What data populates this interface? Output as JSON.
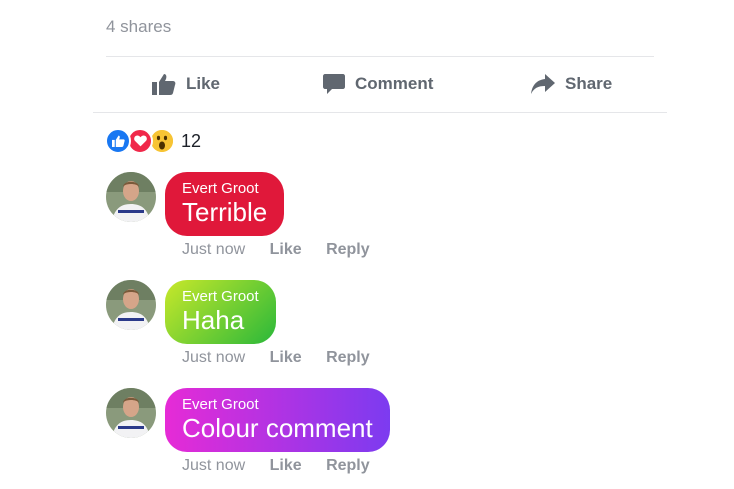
{
  "post": {
    "shares_text": "4 shares"
  },
  "actions": {
    "like": "Like",
    "comment": "Comment",
    "share": "Share"
  },
  "reactions": {
    "types": [
      "like-icon",
      "love-icon",
      "wow-icon"
    ],
    "count": "12"
  },
  "comments": [
    {
      "author": "Evert Groot",
      "text": "Terrible",
      "time": "Just now",
      "like": "Like",
      "reply": "Reply",
      "bubble_color": "#e0183a"
    },
    {
      "author": "Evert Groot",
      "text": "Haha",
      "time": "Just now",
      "like": "Like",
      "reply": "Reply",
      "bubble_colors": [
        "#c8e82a",
        "#2ab83a"
      ]
    },
    {
      "author": "Evert Groot",
      "text": "Colour comment",
      "time": "Just now",
      "like": "Like",
      "reply": "Reply",
      "bubble_colors": [
        "#e62bd6",
        "#7c3bf0"
      ]
    }
  ]
}
